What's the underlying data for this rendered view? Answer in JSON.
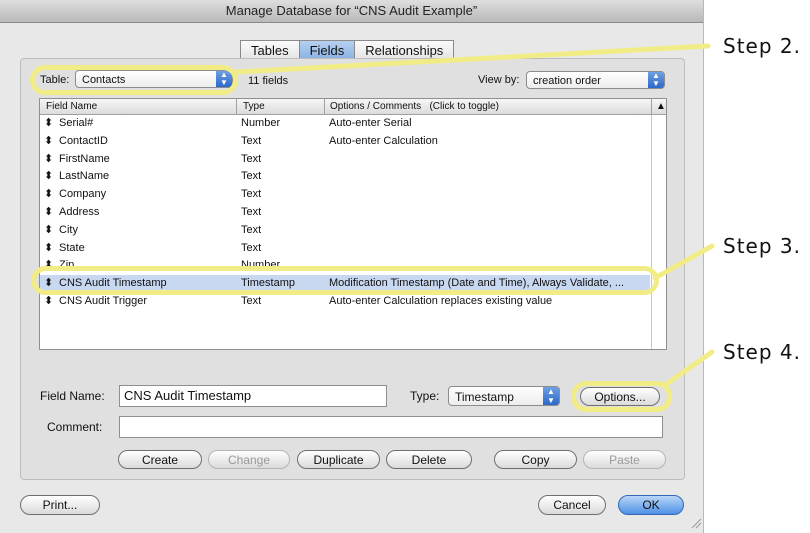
{
  "window": {
    "title": "Manage Database for “CNS Audit Example”"
  },
  "tabs": [
    {
      "label": "Tables"
    },
    {
      "label": "Fields"
    },
    {
      "label": "Relationships"
    }
  ],
  "table_selector": {
    "label": "Table:",
    "value": "Contacts",
    "count": "11 fields"
  },
  "view_by": {
    "label": "View by:",
    "value": "creation order"
  },
  "columns": {
    "name": "Field Name",
    "type": "Type",
    "options": "Options / Comments   (Click to toggle)"
  },
  "fields": [
    {
      "name": "Serial#",
      "type": "Number",
      "options": "Auto-enter Serial"
    },
    {
      "name": "ContactID",
      "type": "Text",
      "options": "Auto-enter Calculation"
    },
    {
      "name": "FirstName",
      "type": "Text",
      "options": ""
    },
    {
      "name": "LastName",
      "type": "Text",
      "options": ""
    },
    {
      "name": "Company",
      "type": "Text",
      "options": ""
    },
    {
      "name": "Address",
      "type": "Text",
      "options": ""
    },
    {
      "name": "City",
      "type": "Text",
      "options": ""
    },
    {
      "name": "State",
      "type": "Text",
      "options": ""
    },
    {
      "name": "Zip",
      "type": "Number",
      "options": ""
    },
    {
      "name": "CNS Audit Timestamp",
      "type": "Timestamp",
      "options": "Modification Timestamp (Date and Time), Always Validate, ...",
      "selected": true
    },
    {
      "name": "CNS Audit Trigger",
      "type": "Text",
      "options": "Auto-enter Calculation replaces existing value"
    }
  ],
  "editor": {
    "field_name_label": "Field Name:",
    "field_name_value": "CNS Audit Timestamp",
    "type_label": "Type:",
    "type_value": "Timestamp",
    "options_button": "Options...",
    "comment_label": "Comment:",
    "comment_value": ""
  },
  "actions": {
    "create": "Create",
    "change": "Change",
    "duplicate": "Duplicate",
    "delete": "Delete",
    "copy": "Copy",
    "paste": "Paste"
  },
  "footer": {
    "print": "Print...",
    "cancel": "Cancel",
    "ok": "OK"
  },
  "annotations": {
    "step2": "Step 2.",
    "step3": "Step 3.",
    "step4": "Step 4."
  },
  "colors": {
    "highlight": "#f2ec87",
    "selection": "#c8d8f1",
    "accent": "#4e90e6"
  }
}
